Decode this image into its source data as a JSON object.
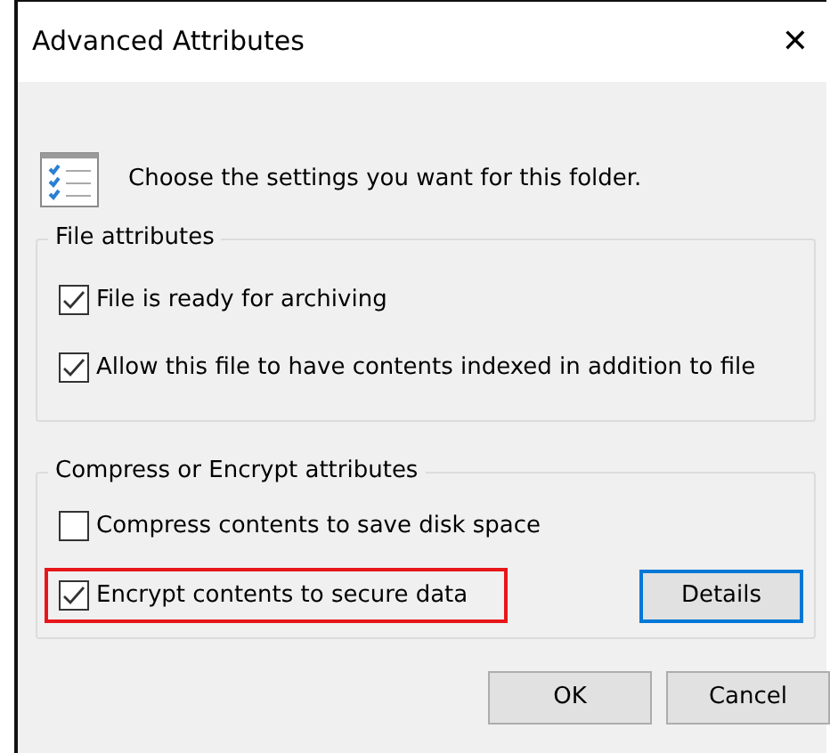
{
  "window": {
    "title": "Advanced Attributes",
    "close": "✕"
  },
  "header": {
    "text": "Choose the settings you want for this folder."
  },
  "groups": [
    {
      "title": "File attributes",
      "options": [
        {
          "label": "File is ready for archiving",
          "checked": true,
          "highlighted": false
        },
        {
          "label": "Allow this file to have contents indexed in addition to file",
          "checked": true,
          "highlighted": false
        }
      ]
    },
    {
      "title": "Compress or Encrypt attributes",
      "options": [
        {
          "label": "Compress contents to save disk space",
          "checked": false,
          "highlighted": false
        },
        {
          "label": "Encrypt contents to secure data",
          "checked": true,
          "highlighted": true
        }
      ],
      "button": {
        "label": "Details",
        "focused": true
      }
    }
  ],
  "buttons": [
    {
      "label": "OK"
    },
    {
      "label": "Cancel"
    }
  ]
}
